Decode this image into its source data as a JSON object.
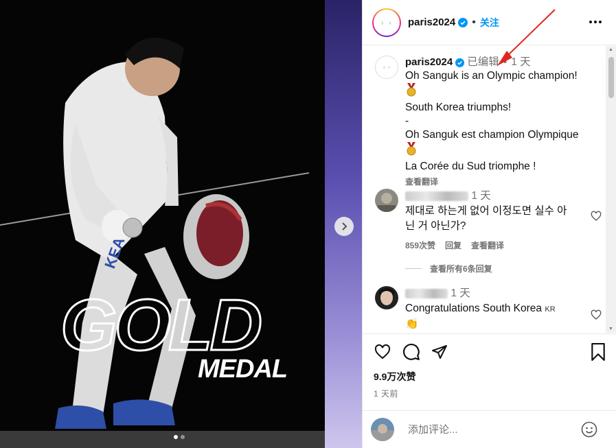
{
  "post": {
    "username": "paris2024",
    "follow_label": "关注",
    "avatar_mark": "♁ ♁",
    "image_text_big": "GOLD",
    "image_text_sub": "MEDAL",
    "image_jersey": "KEA",
    "carousel_active": 1,
    "carousel_count": 2
  },
  "caption": {
    "username": "paris2024",
    "edited": "已编辑",
    "time": "1 天",
    "line1": "Oh Sanguk is an Olympic champion!",
    "line2": "South Korea triumphs!",
    "dash": "-",
    "line3": "Oh Sanguk est champion Olympique",
    "line4": "La Corée du Sud triomphe !",
    "see_translation": "查看翻译"
  },
  "comments": [
    {
      "time": "1 天",
      "text": "제대로 하는게 없어 이정도면 실수 아닌 거 아닌가?",
      "likes": "859次赞",
      "reply": "回复",
      "see_translation": "查看翻译"
    },
    {
      "time": "1 天",
      "text": "Congratulations South Korea",
      "flag": "KR",
      "emoji": "👏"
    }
  ],
  "view_replies": "查看所有6条回复",
  "stats": {
    "likes": "9.9万次赞",
    "posted": "1 天前"
  },
  "comment_input": {
    "placeholder": "添加评论..."
  },
  "colors": {
    "link_blue": "#0095f6",
    "muted": "#737373",
    "annotation_red": "#e0271f"
  }
}
